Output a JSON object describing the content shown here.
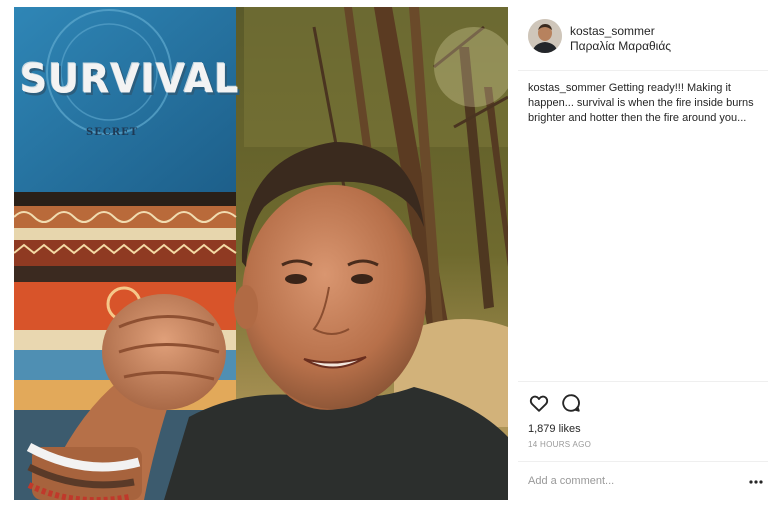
{
  "post": {
    "username": "kostas_sommer",
    "location": "Παραλία Μαραθιάς",
    "caption": {
      "user": "kostas_sommer",
      "text": "Getting ready!!! Making it happen... survival is when the fire inside burns brighter and hotter then the fire around you..."
    },
    "photo": {
      "banner_text": "SURVIVAL",
      "banner_subtext": "SECRET"
    },
    "actions": {
      "like_icon": "heart-outline-icon",
      "comment_icon": "speech-bubble-icon"
    },
    "likes": "1,879 likes",
    "timestamp": "14 HOURS AGO",
    "comment_placeholder": "Add a comment...",
    "more_icon": "ellipsis-icon"
  },
  "colors": {
    "text": "#262626",
    "muted": "#999999",
    "divider": "#efefef"
  }
}
